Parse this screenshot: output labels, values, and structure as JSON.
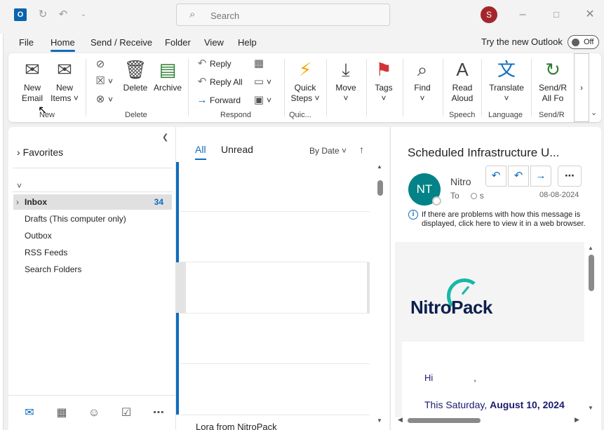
{
  "titlebar": {
    "app_icon": "outlook-icon",
    "search_placeholder": "Search",
    "user_initial": "S"
  },
  "menu": {
    "tabs": [
      "File",
      "Home",
      "Send / Receive",
      "Folder",
      "View",
      "Help"
    ],
    "active": "Home",
    "try_new": "Try the new Outlook",
    "toggle_label": "Off"
  },
  "ribbon": {
    "new_email": [
      "New",
      "Email"
    ],
    "new_items": [
      "New",
      "Items ˅"
    ],
    "group_new": "New",
    "delete": "Delete",
    "archive": "Archive",
    "group_delete": "Delete",
    "reply": "Reply",
    "reply_all": "Reply All",
    "forward": "Forward",
    "group_respond": "Respond",
    "quick_steps": [
      "Quick",
      "Steps ˅"
    ],
    "group_quick": "Quic...",
    "move": "Move",
    "tags": "Tags",
    "find": "Find",
    "read_aloud": [
      "Read",
      "Aloud"
    ],
    "group_speech": "Speech",
    "translate": "Translate",
    "group_language": "Language",
    "send_receive": [
      "Send/R",
      "All Fo"
    ],
    "group_send": "Send/R"
  },
  "folders": {
    "favorites": "Favorites",
    "items": [
      {
        "label": "Inbox",
        "count": "34"
      },
      {
        "label": "Drafts (This computer only)",
        "count": ""
      },
      {
        "label": "Outbox",
        "count": ""
      },
      {
        "label": "RSS Feeds",
        "count": ""
      },
      {
        "label": "Search Folders",
        "count": ""
      }
    ]
  },
  "message_list": {
    "tab_all": "All",
    "tab_unread": "Unread",
    "sort": "By Date",
    "preview_sender": "Lora from NitroPack"
  },
  "reading": {
    "subject": "Scheduled Infrastructure U...",
    "avatar_initials": "NT",
    "from": "Nitro",
    "to_label": "To",
    "to_value": "s",
    "date": "08-08-2024",
    "info": "If there are problems with how this message is displayed, click here to view it in a web browser.",
    "logo_text": "NitroPack",
    "greeting": "Hi",
    "greeting_comma": ",",
    "body_prefix": "This Saturday, ",
    "body_bold": "August 10, 2024"
  },
  "colors": {
    "accent": "#0f6cbd",
    "avatar_bg": "#038387",
    "user_avatar_bg": "#a4262c"
  }
}
